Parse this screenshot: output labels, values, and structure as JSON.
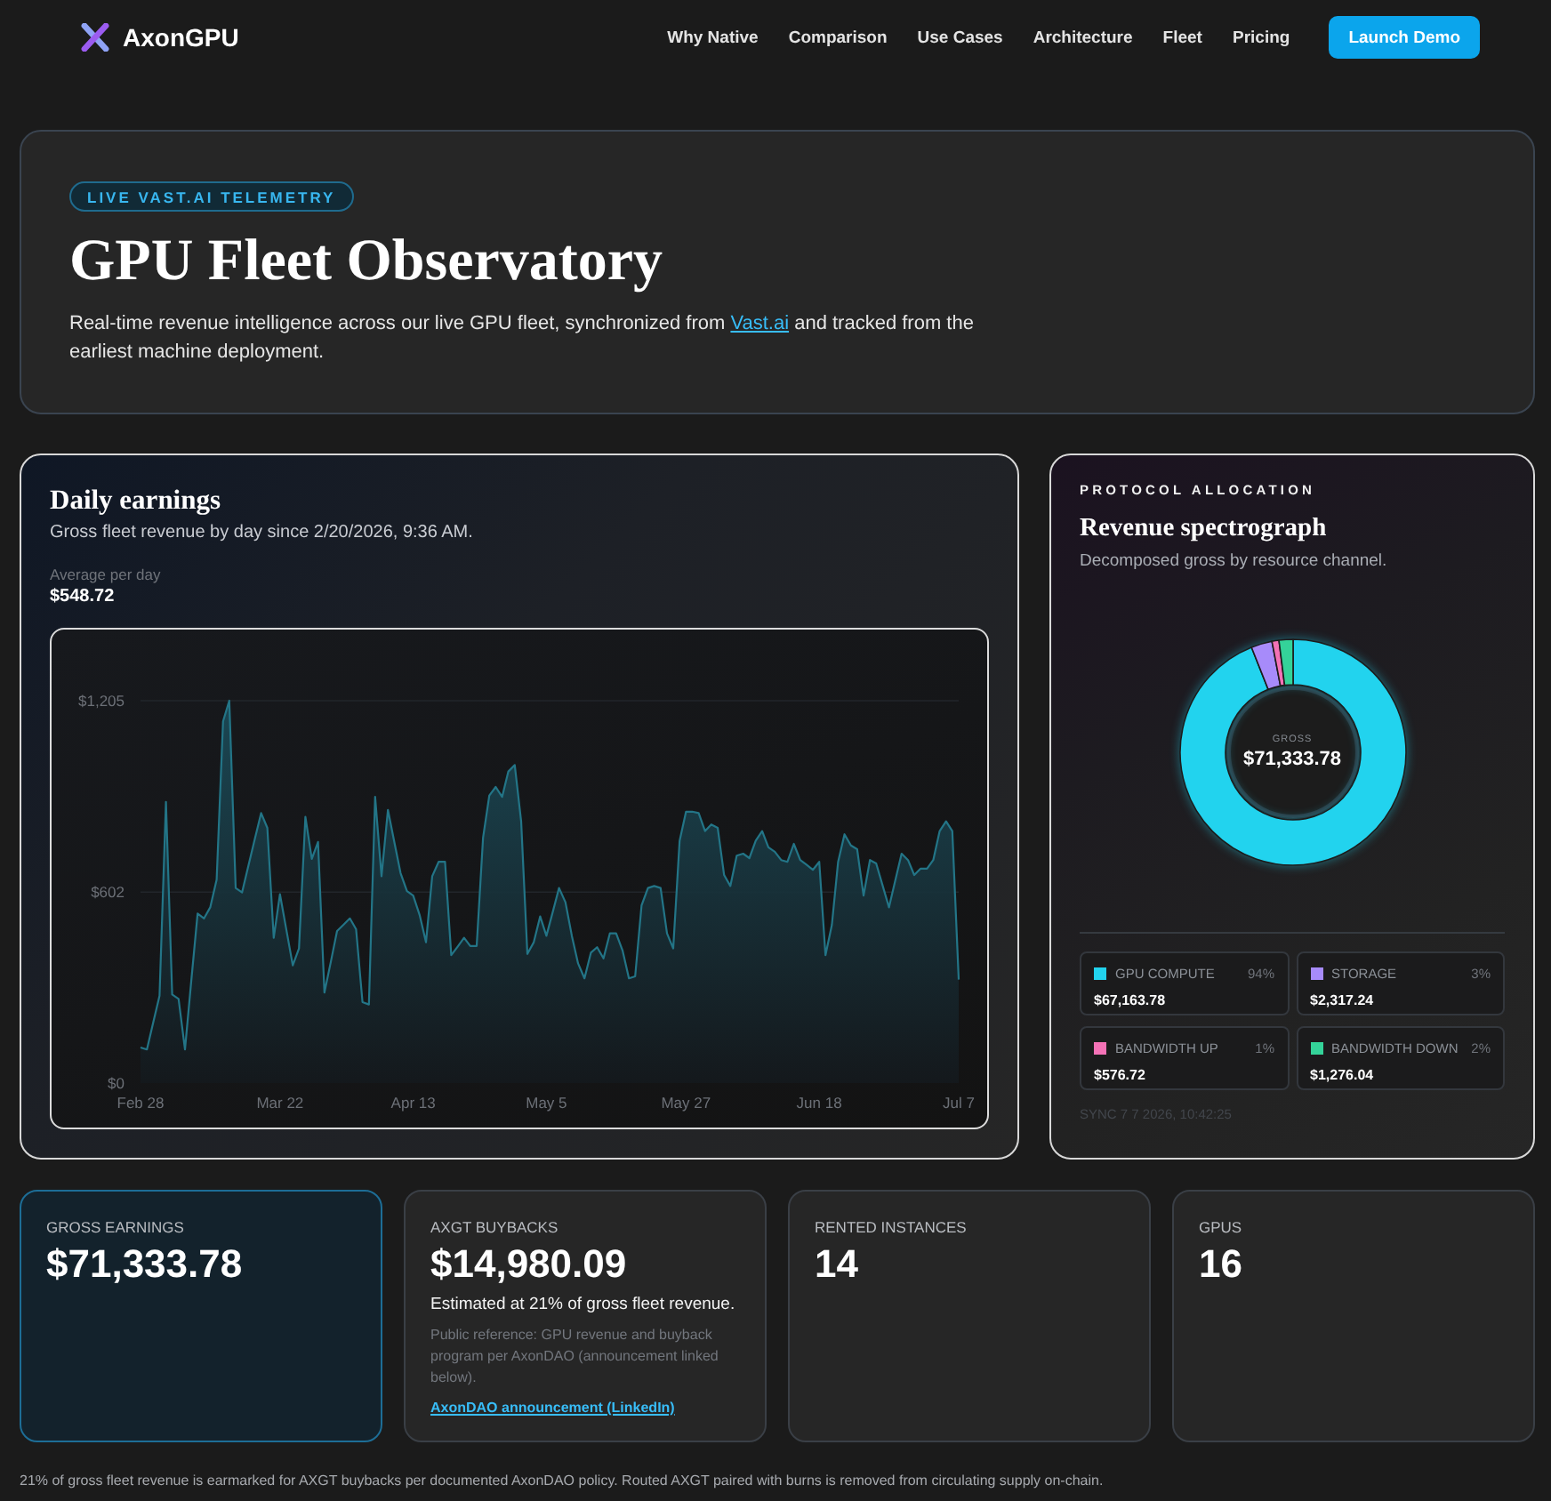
{
  "nav": {
    "brand": "AxonGPU",
    "links": [
      "Why Native",
      "Comparison",
      "Use Cases",
      "Architecture",
      "Fleet",
      "Pricing"
    ],
    "cta": "Launch Demo"
  },
  "hero": {
    "badge": "LIVE VAST.AI TELEMETRY",
    "title": "GPU Fleet Observatory",
    "description": [
      {
        "kind": "text",
        "text": "Real-time revenue intelligence across our live GPU fleet, synchronized from "
      },
      {
        "kind": "link",
        "text": "Vast.ai"
      },
      {
        "kind": "text",
        "text": " and tracked from the earliest machine deployment."
      }
    ]
  },
  "earnings": {
    "title": "Daily earnings",
    "subtitle": "Gross fleet revenue by day since 2/20/2026, 9:36 AM.",
    "average_label": "Average per day",
    "average_value": "$548.72",
    "chart_data": {
      "type": "area",
      "categories": [
        "Feb 28",
        null,
        null,
        null,
        null,
        null,
        null,
        null,
        null,
        null,
        null,
        null,
        null,
        null,
        null,
        null,
        null,
        null,
        null,
        null,
        null,
        null,
        "Mar 22",
        null,
        null,
        null,
        null,
        null,
        null,
        null,
        null,
        null,
        null,
        null,
        null,
        null,
        null,
        null,
        null,
        null,
        null,
        null,
        null,
        "Apr 13",
        null,
        null,
        null,
        null,
        null,
        null,
        null,
        null,
        null,
        null,
        null,
        null,
        null,
        null,
        null,
        null,
        null,
        null,
        null,
        null,
        "May 5",
        null,
        null,
        null,
        null,
        null,
        null,
        null,
        null,
        null,
        null,
        null,
        null,
        null,
        null,
        null,
        null,
        null,
        null,
        null,
        null,
        null,
        "May 27",
        null,
        null,
        null,
        null,
        null,
        null,
        null,
        null,
        null,
        null,
        null,
        null,
        null,
        null,
        null,
        null,
        null,
        null,
        null,
        null,
        "Jun 18",
        null,
        null,
        null,
        null,
        null,
        null,
        null,
        null,
        null,
        null,
        null,
        null,
        null,
        null,
        null,
        null,
        null,
        null,
        null,
        null,
        null,
        "Jul 7"
      ],
      "values": [
        112,
        106,
        190,
        275,
        886,
        279,
        265,
        106,
        320,
        534,
        519,
        554,
        641,
        1140,
        1205,
        615,
        601,
        684,
        768,
        851,
        804,
        458,
        595,
        483,
        371,
        424,
        839,
        707,
        760,
        285,
        382,
        479,
        499,
        519,
        485,
        255,
        248,
        902,
        652,
        861,
        762,
        662,
        605,
        591,
        530,
        444,
        652,
        697,
        697,
        403,
        430,
        458,
        432,
        432,
        774,
        906,
        933,
        902,
        982,
        1002,
        825,
        407,
        444,
        525,
        464,
        540,
        615,
        570,
        464,
        377,
        330,
        411,
        428,
        393,
        472,
        472,
        418,
        330,
        336,
        560,
        615,
        621,
        615,
        472,
        424,
        764,
        855,
        855,
        851,
        794,
        815,
        804,
        656,
        621,
        717,
        723,
        709,
        764,
        794,
        743,
        729,
        703,
        697,
        754,
        703,
        688,
        672,
        697,
        403,
        499,
        697,
        784,
        749,
        737,
        591,
        703,
        692,
        623,
        554,
        638,
        723,
        703,
        656,
        676,
        676,
        703,
        794,
        825,
        794,
        326
      ],
      "ylim": [
        0,
        1205
      ],
      "yticks": [
        {
          "value": 0,
          "label": "$0"
        },
        {
          "value": 602,
          "label": "$602"
        },
        {
          "value": 1205,
          "label": "$1,205"
        }
      ]
    }
  },
  "allocation": {
    "eyebrow": "PROTOCOL ALLOCATION",
    "title": "Revenue spectrograph",
    "subtitle": "Decomposed gross by resource channel.",
    "center_label": "GROSS",
    "center_value": "$71,333.78",
    "chart_data": {
      "type": "donut",
      "categories": [
        "GPU COMPUTE",
        "STORAGE",
        "BANDWIDTH UP",
        "BANDWIDTH DOWN"
      ],
      "values": [
        94,
        3,
        1,
        2
      ]
    },
    "legend": [
      {
        "share": "94%",
        "amount": "$67,163.78",
        "color": "#22d3ee"
      },
      {
        "share": "3%",
        "amount": "$2,317.24",
        "color": "#a78bfa"
      },
      {
        "share": "1%",
        "amount": "$576.72",
        "color": "#f472b6"
      },
      {
        "share": "2%",
        "amount": "$1,276.04",
        "color": "#34d399"
      }
    ],
    "sync": "SYNC 7 7 2026, 10:42:25"
  },
  "stats": [
    {
      "label": "GROSS EARNINGS",
      "value": "$71,333.78",
      "highlighted": true
    },
    {
      "label": "AXGT BUYBACKS",
      "value": "$14,980.09",
      "highlighted": false,
      "detail": "Estimated at 21% of gross fleet revenue.",
      "note": "Public reference: GPU revenue and buyback program per AxonDAO (announcement linked below).",
      "link": "AxonDAO announcement (LinkedIn)"
    },
    {
      "label": "RENTED INSTANCES",
      "value": "14",
      "highlighted": false
    },
    {
      "label": "GPUS",
      "value": "16",
      "highlighted": false
    }
  ],
  "footer": "21% of gross fleet revenue is earmarked for AXGT buybacks per documented AxonDAO policy. Routed AXGT paired with burns is removed from circulating supply on-chain."
}
